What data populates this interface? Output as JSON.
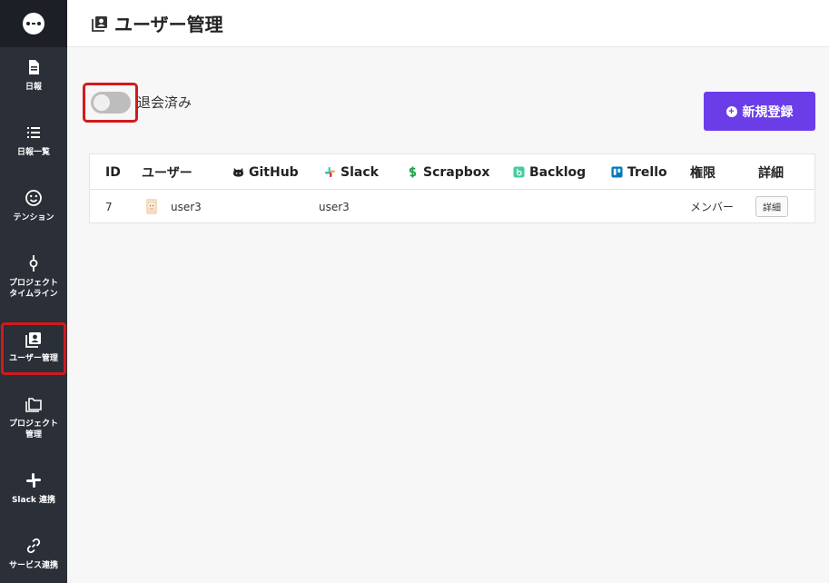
{
  "sidebar": {
    "items": [
      {
        "label": "日報",
        "icon": "document-icon"
      },
      {
        "label": "日報一覧",
        "icon": "list-icon"
      },
      {
        "label": "テンション",
        "icon": "smiley-icon"
      },
      {
        "label": "プロジェクト\nタイムライン",
        "icon": "timeline-icon"
      },
      {
        "label": "ユーザー管理",
        "icon": "user-admin-icon"
      },
      {
        "label": "プロジェクト\n管理",
        "icon": "folder-icon"
      },
      {
        "label": "Slack 連携",
        "icon": "slack-icon"
      },
      {
        "label": "サービス連携",
        "icon": "link-icon"
      }
    ]
  },
  "header": {
    "title": "ユーザー管理"
  },
  "filters": {
    "withdrawn_label": "退会済み",
    "withdrawn_enabled": false
  },
  "actions": {
    "new_register_label": "新規登録"
  },
  "table": {
    "columns": [
      "ID",
      "ユーザー",
      "GitHub",
      "Slack",
      "Scrapbox",
      "Backlog",
      "Trello",
      "権限",
      "詳細"
    ],
    "rows": [
      {
        "id": "7",
        "user": "user3",
        "github": "",
        "slack": "user3",
        "scrapbox": "",
        "backlog": "",
        "trello": "",
        "role": "メンバー",
        "detail_label": "詳細"
      }
    ]
  },
  "colors": {
    "accent": "#6a3de8",
    "highlight": "#d21a1a",
    "sidebar": "#2b2f38"
  }
}
